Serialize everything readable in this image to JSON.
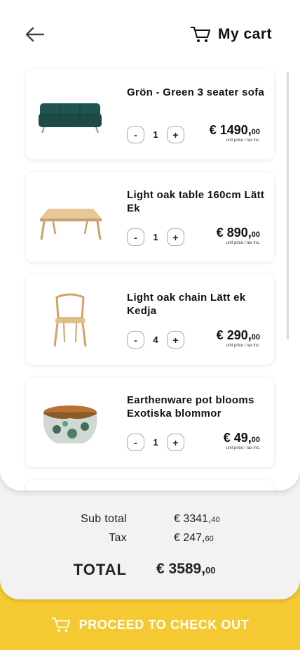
{
  "header": {
    "title": "My cart"
  },
  "items": [
    {
      "name": "Grön - Green 3 seater sofa",
      "qty": "1",
      "price_int": "€ 1490,",
      "price_cents": "00",
      "note": "unit price / tax inc.",
      "minus": "-",
      "plus": "+"
    },
    {
      "name": "Light oak table 160cm Lätt Ek",
      "qty": "1",
      "price_int": "€ 890,",
      "price_cents": "00",
      "note": "unit price / tax inc.",
      "minus": "-",
      "plus": "+"
    },
    {
      "name": "Light oak chain Lätt ek Kedja",
      "qty": "4",
      "price_int": "€ 290,",
      "price_cents": "00",
      "note": "unit price / tax inc.",
      "minus": "-",
      "plus": "+"
    },
    {
      "name": "Earthenware pot blooms Exotiska blommor",
      "qty": "1",
      "price_int": "€ 49,",
      "price_cents": "00",
      "note": "unit price / tax inc.",
      "minus": "-",
      "plus": "+"
    }
  ],
  "summary": {
    "subtotal_label": "Sub total",
    "subtotal_int": "€ 3341,",
    "subtotal_cents": "40",
    "tax_label": "Tax",
    "tax_int": "€ 247,",
    "tax_cents": "60",
    "total_label": "TOTAL",
    "total_int": "€ 3589,",
    "total_cents": "00"
  },
  "checkout": {
    "label": "PROCEED TO CHECK OUT"
  },
  "colors": {
    "accent": "#f5c932",
    "sofa": "#1f5451",
    "wood": "#d9b27a",
    "copper": "#b87333"
  }
}
